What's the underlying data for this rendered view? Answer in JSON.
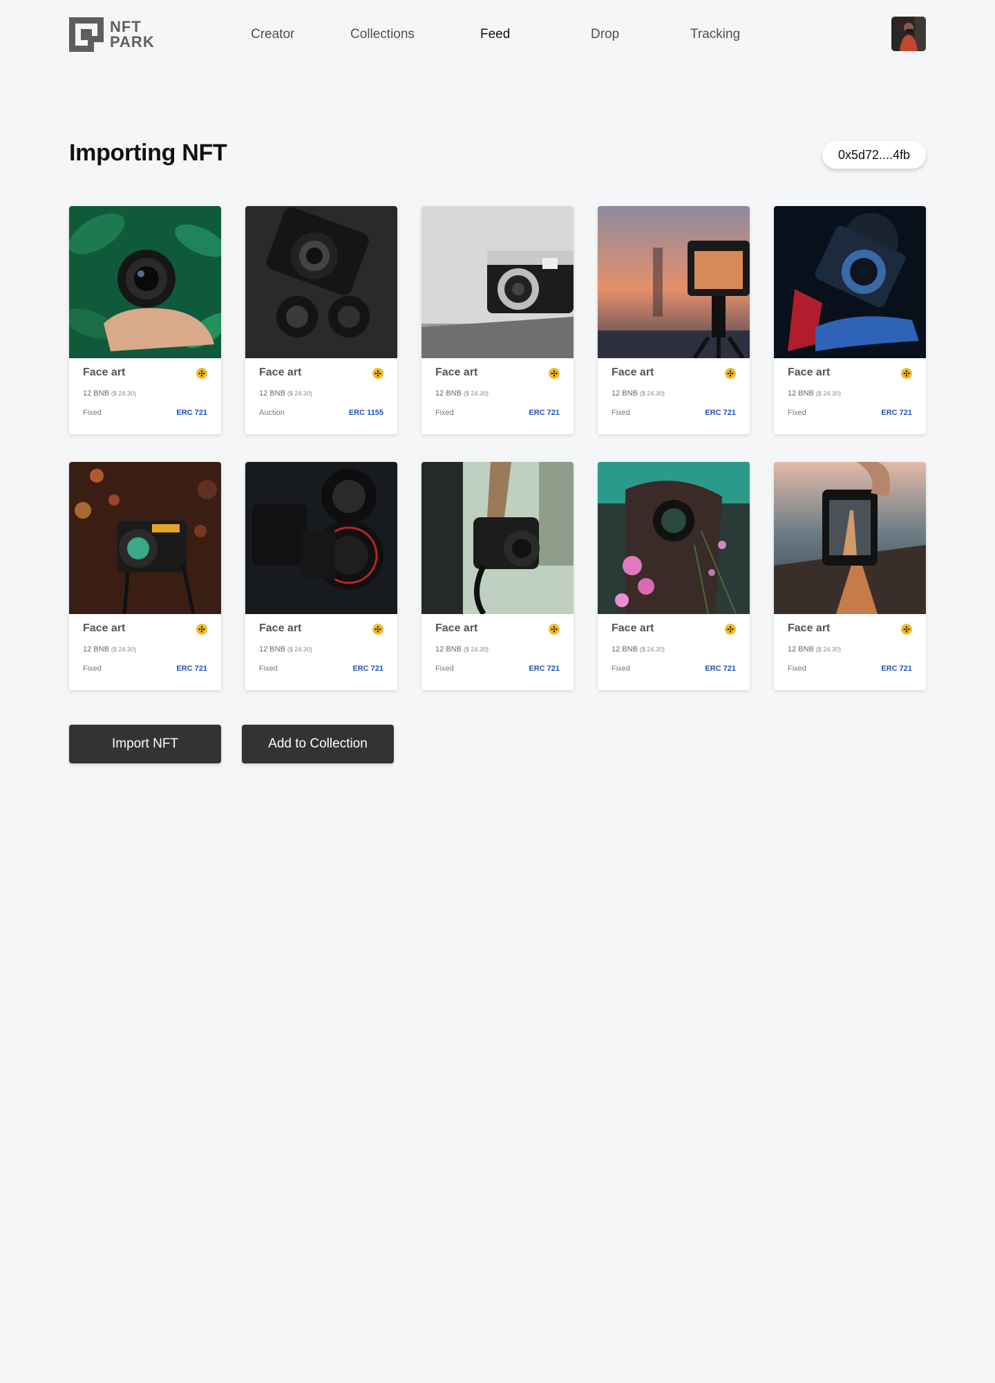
{
  "brand": {
    "name_line1": "NFT",
    "name_line2": "PARK"
  },
  "nav": {
    "items": [
      {
        "label": "Creator",
        "active": false
      },
      {
        "label": "Collections",
        "active": false
      },
      {
        "label": "Feed",
        "active": true
      },
      {
        "label": "Drop",
        "active": false
      },
      {
        "label": "Tracking",
        "active": false
      }
    ]
  },
  "page": {
    "title": "Importing NFT",
    "wallet": "0x5d72....4fb"
  },
  "cards": [
    {
      "name": "Face art",
      "price": "12  BNB",
      "usd": "($ 24.30)",
      "sale_type": "Fixed",
      "standard": "ERC 721",
      "image": "camera-lens-in-hand-green-leaves"
    },
    {
      "name": "Face art",
      "price": "12  BNB",
      "usd": "($ 24.30)",
      "sale_type": "Auction",
      "standard": "ERC 1155",
      "image": "sony-camera-and-lenses-dark"
    },
    {
      "name": "Face art",
      "price": "12  BNB",
      "usd": "($ 24.30)",
      "sale_type": "Fixed",
      "standard": "ERC 721",
      "image": "silver-retro-camera-on-table"
    },
    {
      "name": "Face art",
      "price": "12  BNB",
      "usd": "($ 24.30)",
      "sale_type": "Fixed",
      "standard": "ERC 721",
      "image": "camera-on-tripod-sunset"
    },
    {
      "name": "Face art",
      "price": "12  BNB",
      "usd": "($ 24.30)",
      "sale_type": "Fixed",
      "standard": "ERC 721",
      "image": "camera-neon-red-blue-light"
    },
    {
      "name": "Face art",
      "price": "12  BNB",
      "usd": "($ 24.30)",
      "sale_type": "Fixed",
      "standard": "ERC 721",
      "image": "camera-bokeh-night-street"
    },
    {
      "name": "Face art",
      "price": "12  BNB",
      "usd": "($ 24.30)",
      "sale_type": "Fixed",
      "standard": "ERC 721",
      "image": "canon-cameras-dark"
    },
    {
      "name": "Face art",
      "price": "12  BNB",
      "usd": "($ 24.30)",
      "sale_type": "Fixed",
      "standard": "ERC 721",
      "image": "person-holding-camera-outdoors"
    },
    {
      "name": "Face art",
      "price": "12  BNB",
      "usd": "($ 24.30)",
      "sale_type": "Fixed",
      "standard": "ERC 721",
      "image": "photographer-behind-pink-flowers"
    },
    {
      "name": "Face art",
      "price": "12  BNB",
      "usd": "($ 24.30)",
      "sale_type": "Fixed",
      "standard": "ERC 721",
      "image": "camera-screen-road-view"
    }
  ],
  "actions": {
    "import_label": "Import NFT",
    "add_label": "Add to Collection"
  },
  "colors": {
    "background": "#f5f6f8",
    "button": "#333333",
    "standard_link": "#1d4fbf",
    "bnb": "#f3ba2f"
  }
}
